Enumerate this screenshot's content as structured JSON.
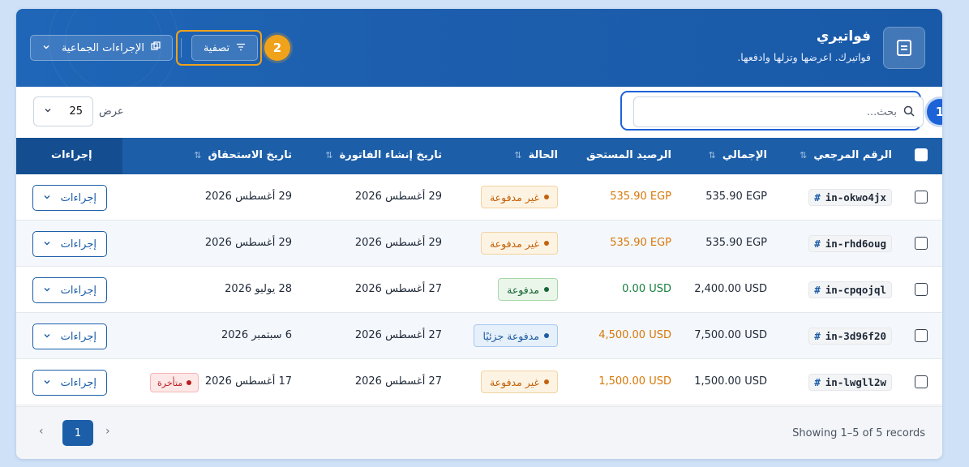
{
  "header": {
    "title": "فواتيري",
    "subtitle": "فواتيرك. اعرضها وتزلها وادفعها.",
    "filter_label": "تصفية",
    "bulk_label": "الإجراءات الجماعية",
    "step_filter": "2",
    "step_search": "1"
  },
  "toolbar": {
    "search_placeholder": "بحث...",
    "show_label": "عرض",
    "page_size": "25"
  },
  "table": {
    "headers": {
      "ref": "الرقم المرجعي",
      "total": "الإجمالي",
      "balance": "الرصيد المستحق",
      "status": "الحالة",
      "created": "تاريخ إنشاء الفاتورة",
      "due": "تاريخ الاستحقاق",
      "actions": "إجراءات"
    },
    "rows": [
      {
        "ref": "in-okwo4jx",
        "total": "535.90 EGP",
        "balance": "535.90 EGP",
        "status": "غير مدفوعة",
        "created": "29 أغسطس 2026",
        "due": "29 أغسطس 2026",
        "action": "إجراءات"
      },
      {
        "ref": "in-rhd6oug",
        "total": "535.90 EGP",
        "balance": "535.90 EGP",
        "status": "غير مدفوعة",
        "created": "29 أغسطس 2026",
        "due": "29 أغسطس 2026",
        "action": "إجراءات"
      },
      {
        "ref": "in-cpqojql",
        "total": "2,400.00 USD",
        "balance": "0.00 USD",
        "status": "مدفوعة",
        "created": "27 أغسطس 2026",
        "due": "28 يوليو 2026",
        "action": "إجراءات"
      },
      {
        "ref": "in-3d96f20",
        "total": "7,500.00 USD",
        "balance": "4,500.00 USD",
        "status": "مدفوعة جزئيًا",
        "created": "27 أغسطس 2026",
        "due": "6 سبتمبر 2026",
        "action": "إجراءات"
      },
      {
        "ref": "in-lwgll2w",
        "total": "1,500.00 USD",
        "balance": "1,500.00 USD",
        "status": "غير مدفوعة",
        "created": "27 أغسطس 2026",
        "due": "17 أغسطس 2026",
        "overdue": "متأخرة",
        "action": "إجراءات"
      }
    ]
  },
  "footer": {
    "records": "Showing 1–5 of 5 records",
    "current_page": "1"
  },
  "colors": {
    "header_blue": "#1c5ea8",
    "highlight_orange": "#f0a21b",
    "highlight_blue": "#1d63d8"
  }
}
